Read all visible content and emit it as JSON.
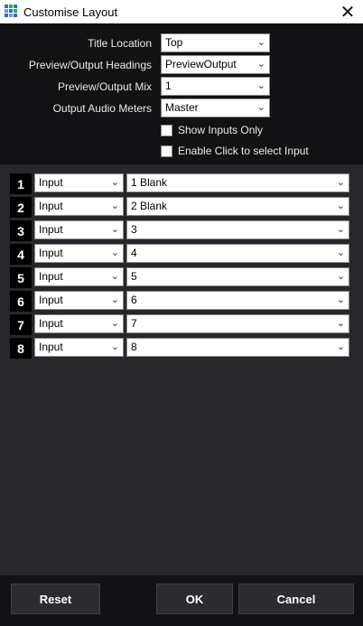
{
  "window": {
    "title": "Customise Layout",
    "close_icon": "✕"
  },
  "settings": {
    "title_location": {
      "label": "Title Location",
      "value": "Top"
    },
    "headings": {
      "label": "Preview/Output Headings",
      "value": "PreviewOutput"
    },
    "mix": {
      "label": "Preview/Output Mix",
      "value": "1"
    },
    "audio": {
      "label": "Output Audio Meters",
      "value": "Master"
    },
    "show_inputs_only": {
      "label": "Show Inputs Only",
      "checked": false
    },
    "click_select": {
      "label": "Enable Click to select Input",
      "checked": false
    }
  },
  "rows": [
    {
      "num": "1",
      "type": "Input",
      "value": "1 Blank"
    },
    {
      "num": "2",
      "type": "Input",
      "value": "2 Blank"
    },
    {
      "num": "3",
      "type": "Input",
      "value": "3"
    },
    {
      "num": "4",
      "type": "Input",
      "value": "4"
    },
    {
      "num": "5",
      "type": "Input",
      "value": "5"
    },
    {
      "num": "6",
      "type": "Input",
      "value": "6"
    },
    {
      "num": "7",
      "type": "Input",
      "value": "7"
    },
    {
      "num": "8",
      "type": "Input",
      "value": "8"
    }
  ],
  "footer": {
    "reset": "Reset",
    "ok": "OK",
    "cancel": "Cancel"
  },
  "icons": {
    "chevron": "chevron-down-icon",
    "app": "grid-app-icon",
    "close": "close-icon"
  }
}
